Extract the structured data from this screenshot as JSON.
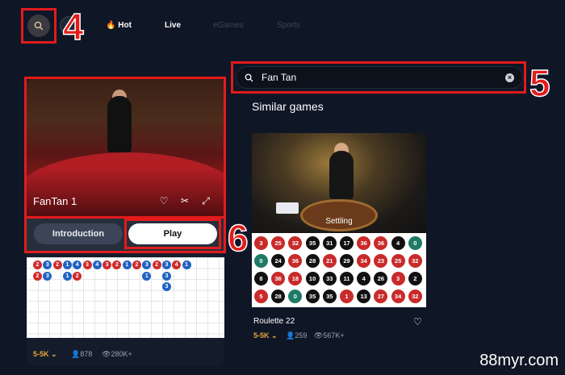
{
  "nav": {
    "items": [
      {
        "label": "Hot",
        "icon": "flame-icon",
        "state": "active"
      },
      {
        "label": "Live",
        "state": "active"
      },
      {
        "label": "eGames",
        "state": "dim"
      },
      {
        "label": "Sports",
        "state": "dim"
      }
    ]
  },
  "annotations": {
    "step4": "4",
    "step5": "5",
    "step6": "6",
    "color": "#e21b1b"
  },
  "search": {
    "value": "Fan Tan"
  },
  "similar": {
    "title": "Similar games"
  },
  "left_card": {
    "title": "FanTan 1",
    "intro_label": "Introduction",
    "play_label": "Play",
    "limit": "5-5K",
    "players": "878",
    "views": "280K+",
    "road": [
      [
        "2",
        "2"
      ],
      [
        "3",
        "3"
      ],
      [
        "2"
      ],
      [
        "1",
        "1"
      ],
      [
        "4",
        "2"
      ],
      [
        "3"
      ],
      [
        "4"
      ],
      [
        "3"
      ],
      [
        "2"
      ],
      [
        "1"
      ],
      [
        "2"
      ],
      [
        "3",
        "1"
      ],
      [
        "2"
      ],
      [
        "3",
        "3",
        "3"
      ],
      [
        "4"
      ],
      [
        "1"
      ]
    ],
    "road_colors": [
      [
        "r",
        "r"
      ],
      [
        "b",
        "b"
      ],
      [
        "r"
      ],
      [
        "b",
        "b"
      ],
      [
        "b",
        "r"
      ],
      [
        "r"
      ],
      [
        "b"
      ],
      [
        "r"
      ],
      [
        "r"
      ],
      [
        "b"
      ],
      [
        "r"
      ],
      [
        "b",
        "b"
      ],
      [
        "r"
      ],
      [
        "b",
        "b",
        "b"
      ],
      [
        "r"
      ],
      [
        "b"
      ]
    ]
  },
  "right_card": {
    "name": "Roulette 22",
    "status": "Settling",
    "limit": "5-5K",
    "players": "259",
    "views": "567K+",
    "results": [
      [
        {
          "n": "3",
          "c": "red"
        },
        {
          "n": "25",
          "c": "red"
        },
        {
          "n": "32",
          "c": "red"
        },
        {
          "n": "35",
          "c": "black"
        },
        {
          "n": "31",
          "c": "black"
        },
        {
          "n": "17",
          "c": "black"
        },
        {
          "n": "36",
          "c": "red"
        },
        {
          "n": "36",
          "c": "red"
        },
        {
          "n": "4",
          "c": "black"
        },
        {
          "n": "0",
          "c": "green"
        }
      ],
      [
        {
          "n": "0",
          "c": "green"
        },
        {
          "n": "24",
          "c": "black"
        },
        {
          "n": "36",
          "c": "red"
        },
        {
          "n": "28",
          "c": "black"
        },
        {
          "n": "21",
          "c": "red"
        },
        {
          "n": "29",
          "c": "black"
        },
        {
          "n": "34",
          "c": "red"
        },
        {
          "n": "23",
          "c": "red"
        },
        {
          "n": "25",
          "c": "red"
        },
        {
          "n": "32",
          "c": "red"
        }
      ],
      [
        {
          "n": "8",
          "c": "black"
        },
        {
          "n": "36",
          "c": "red"
        },
        {
          "n": "18",
          "c": "red"
        },
        {
          "n": "10",
          "c": "black"
        },
        {
          "n": "33",
          "c": "black"
        },
        {
          "n": "11",
          "c": "black"
        },
        {
          "n": "4",
          "c": "black"
        },
        {
          "n": "26",
          "c": "black"
        },
        {
          "n": "3",
          "c": "red"
        },
        {
          "n": "2",
          "c": "black"
        }
      ],
      [
        {
          "n": "5",
          "c": "red"
        },
        {
          "n": "28",
          "c": "black"
        },
        {
          "n": "0",
          "c": "green"
        },
        {
          "n": "35",
          "c": "black"
        },
        {
          "n": "35",
          "c": "black"
        },
        {
          "n": "1",
          "c": "red"
        },
        {
          "n": "13",
          "c": "black"
        },
        {
          "n": "27",
          "c": "red"
        },
        {
          "n": "34",
          "c": "red"
        },
        {
          "n": "32",
          "c": "red"
        }
      ]
    ]
  },
  "watermark": "88myr.com"
}
